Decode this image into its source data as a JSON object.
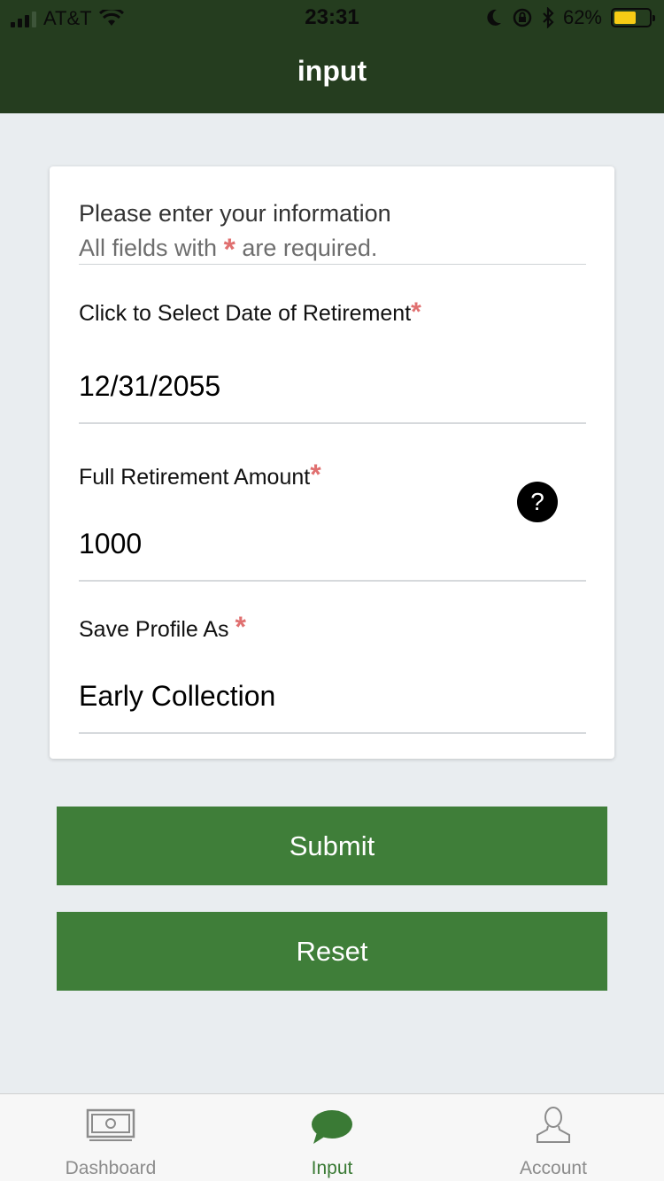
{
  "status_bar": {
    "carrier": "AT&T",
    "time": "23:31",
    "battery": "62%",
    "battery_level": 0.62
  },
  "header": {
    "title": "input"
  },
  "form": {
    "intro_line1": "Please enter your information",
    "intro_line2_pre": "All fields with",
    "intro_line2_post": "are required.",
    "required_mark": "*",
    "fields": [
      {
        "label": "Click to Select Date of Retirement",
        "value": "12/31/2055"
      },
      {
        "label": "Full Retirement Amount",
        "value": "1000"
      },
      {
        "label": "Save Profile As",
        "value": "Early Collection"
      }
    ],
    "help_label": "?"
  },
  "buttons": {
    "submit": "Submit",
    "reset": "Reset"
  },
  "tabs": [
    {
      "label": "Dashboard",
      "icon": "money-icon"
    },
    {
      "label": "Input",
      "icon": "chat-bubble-icon",
      "active": true
    },
    {
      "label": "Account",
      "icon": "user-icon"
    }
  ],
  "colors": {
    "header": "#253d1f",
    "button": "#3f7e39",
    "required": "#e07070",
    "active_tab": "#3a7a35"
  }
}
